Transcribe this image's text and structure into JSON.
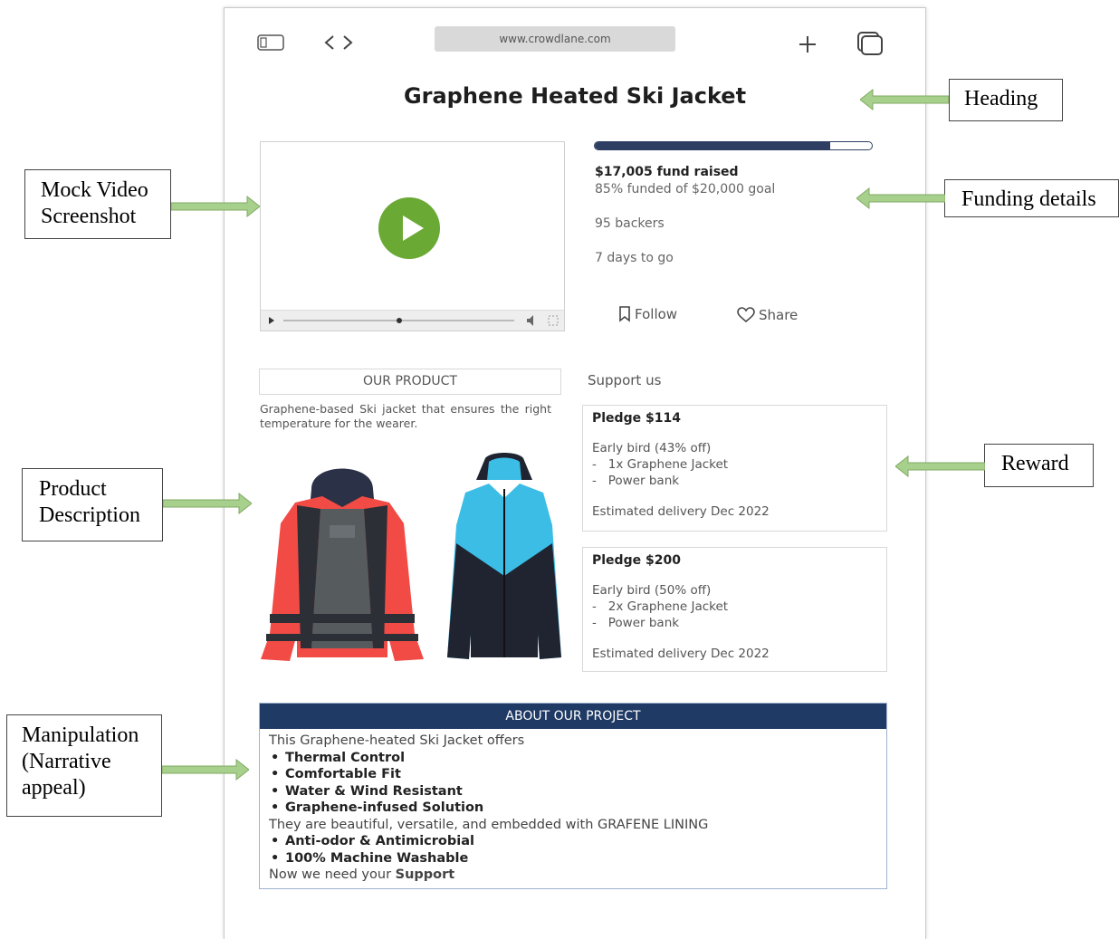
{
  "browser": {
    "url": "www.crowdlane.com"
  },
  "page": {
    "title": "Graphene Heated Ski Jacket"
  },
  "funding": {
    "progress_fraction": 0.85,
    "raised": "$17,005 fund raised",
    "funded": "85% funded of $20,000 goal",
    "backers": "95 backers",
    "days": "7 days to go",
    "follow_label": "Follow",
    "share_label": "Share"
  },
  "product": {
    "heading": "OUR PRODUCT",
    "description": "Graphene-based Ski jacket that ensures the right temperature for the wearer."
  },
  "support": {
    "heading": "Support us",
    "pledges": [
      {
        "title": "Pledge $114",
        "offer": "Early bird (43% off)",
        "items": [
          "-   1x Graphene Jacket",
          "-   Power bank"
        ],
        "delivery": "Estimated delivery Dec 2022"
      },
      {
        "title": "Pledge $200",
        "offer": "Early bird (50% off)",
        "items": [
          "-   2x Graphene Jacket",
          "-   Power bank"
        ],
        "delivery": "Estimated delivery Dec 2022"
      }
    ]
  },
  "about": {
    "heading": "ABOUT OUR PROJECT",
    "intro": "This  Graphene-heated Ski Jacket offers",
    "bullets1": [
      "Thermal Control",
      "Comfortable Fit",
      "Water & Wind Resistant",
      "Graphene-infused Solution"
    ],
    "middle": "They are beautiful, versatile, and embedded with GRAFENE LINING",
    "bullets2": [
      "Anti-odor & Antimicrobial",
      "100% Machine Washable"
    ],
    "closing_prefix": "Now we need your ",
    "closing_bold": "Support"
  },
  "annotations": {
    "heading": "Heading",
    "funding": "Funding details",
    "video": [
      "Mock Video",
      "Screenshot"
    ],
    "reward": "Reward",
    "product": [
      "Product",
      "Description"
    ],
    "manipulation": [
      "Manipulation",
      "(Narrative",
      "appeal)"
    ]
  },
  "colors": {
    "accent_navy": "#1f3a64",
    "play_green": "#6aa934",
    "arrow_green": "#a8d08d",
    "jacket_red": "#f24b45",
    "jacket_cyan": "#3bbde6"
  },
  "icons": [
    "sidebar-icon",
    "back-icon",
    "forward-icon",
    "plus-icon",
    "tabs-icon",
    "play-icon",
    "bookmark-icon",
    "heart-icon"
  ]
}
